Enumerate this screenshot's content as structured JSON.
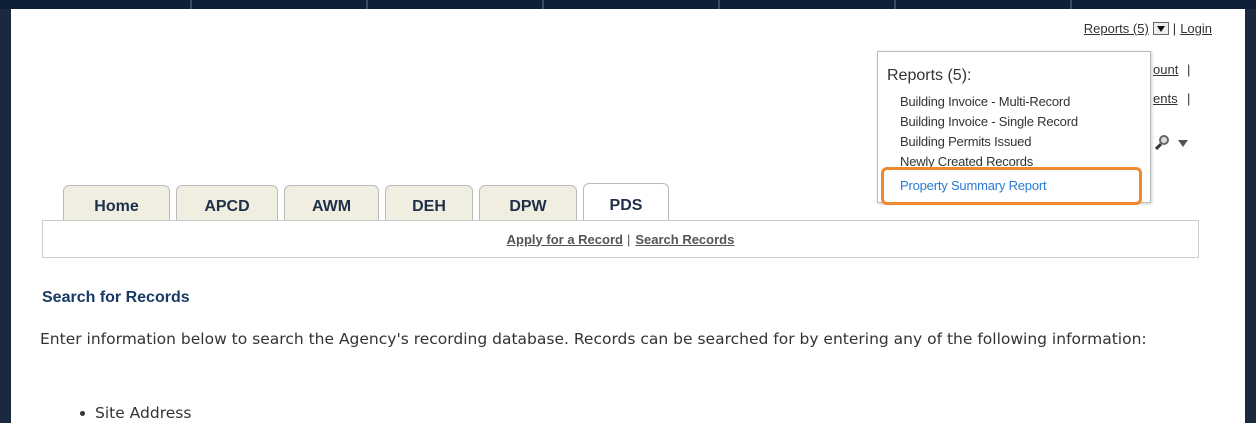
{
  "header": {
    "reports_link": "Reports (5)",
    "pipe": "|",
    "login_link": "Login",
    "account_fragment": "ount",
    "account_pipe": "|",
    "ents_fragment": "ents",
    "ents_pipe": "|"
  },
  "reports_menu": {
    "title": "Reports (5):",
    "items": [
      "Building Invoice - Multi-Record",
      "Building Invoice - Single Record",
      "Building Permits Issued",
      "Newly Created Records",
      "Property Summary Report"
    ],
    "highlighted_index": 4,
    "highlight_color": "#f0882e"
  },
  "tabs": [
    {
      "label": "Home"
    },
    {
      "label": "APCD"
    },
    {
      "label": "AWM"
    },
    {
      "label": "DEH"
    },
    {
      "label": "DPW"
    },
    {
      "label": "PDS",
      "active": true
    }
  ],
  "subnav": {
    "apply": "Apply for a Record",
    "pipe": "|",
    "search": "Search Records"
  },
  "main": {
    "heading": "Search for Records",
    "intro": "Enter information below to search the Agency's recording database. Records can be searched for by entering any of the following information:",
    "list": [
      "Site Address"
    ]
  },
  "colors": {
    "heading": "#1a3a66",
    "link_blue": "#2a7ad5",
    "tab_bg": "#efeee0"
  }
}
